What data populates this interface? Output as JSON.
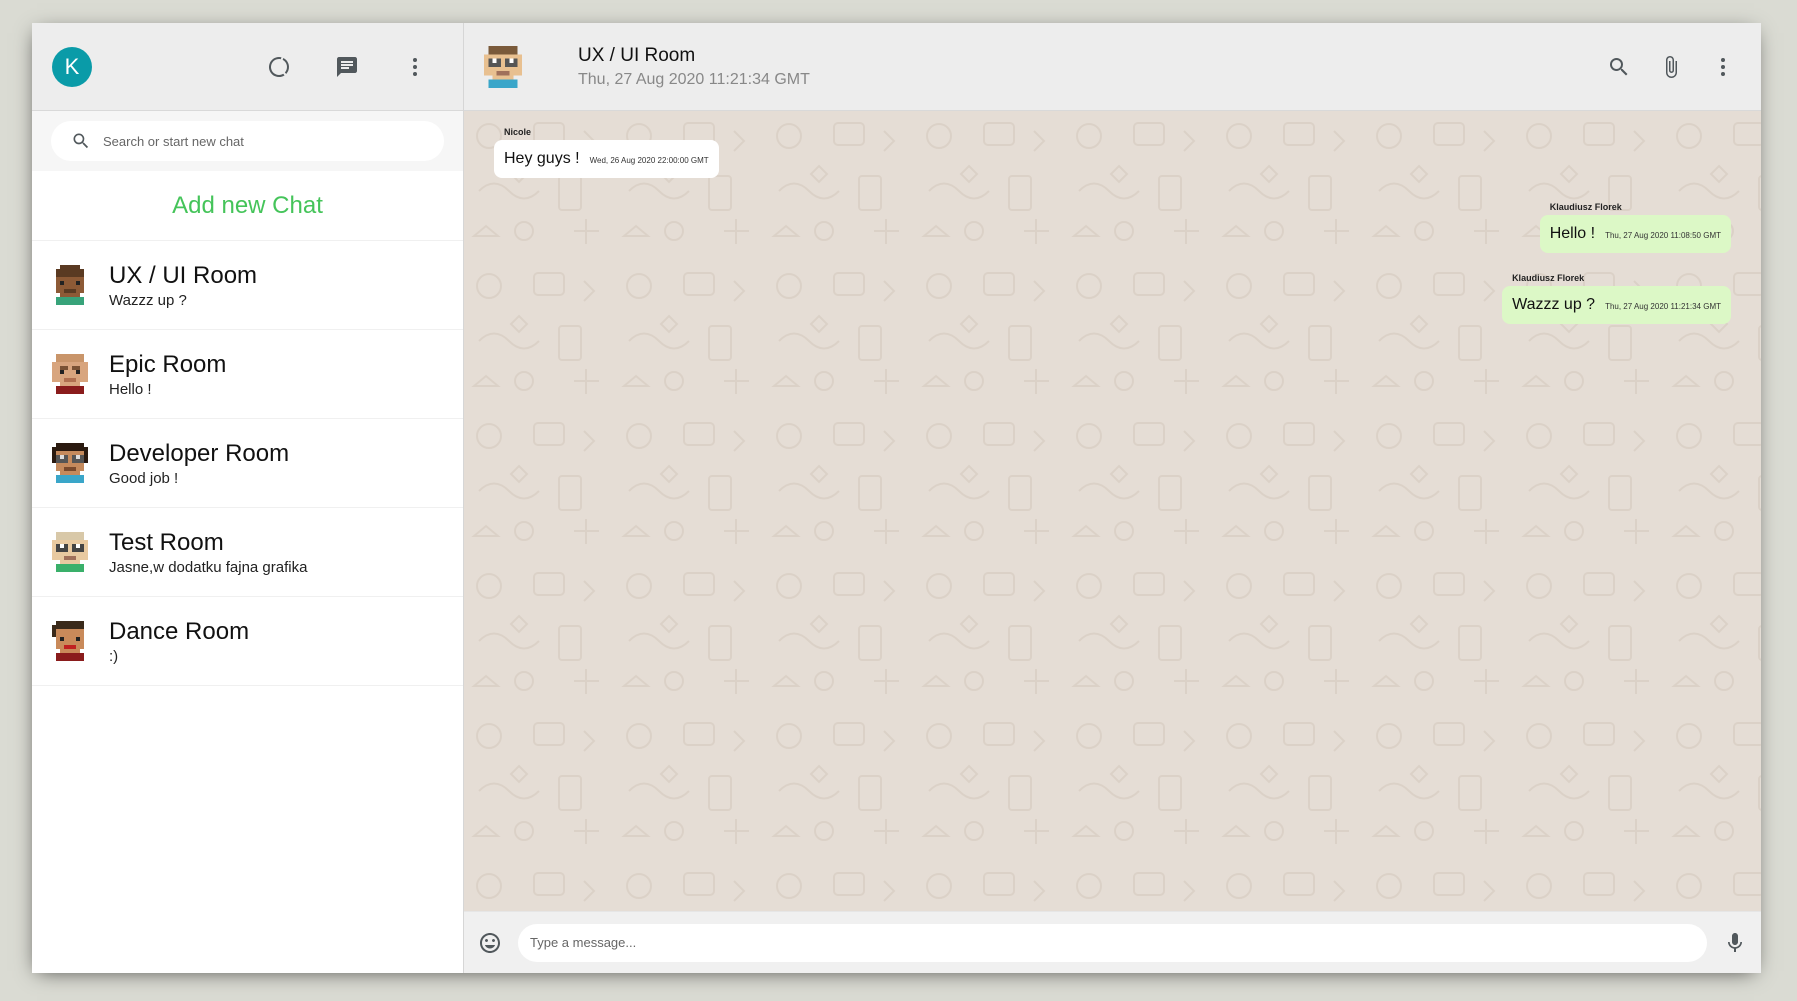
{
  "user": {
    "initial": "K"
  },
  "sidebar": {
    "search_placeholder": "Search or start new chat",
    "add_chat_label": "Add new Chat",
    "rooms": [
      {
        "name": "UX / UI Room",
        "last": "Wazzz up ?",
        "avatar": "pixel-avatar-brown"
      },
      {
        "name": "Epic Room",
        "last": "Hello !",
        "avatar": "pixel-avatar-tan"
      },
      {
        "name": "Developer Room",
        "last": "Good job !",
        "avatar": "pixel-avatar-glasses"
      },
      {
        "name": "Test Room",
        "last": "Jasne,w dodatku fajna grafika",
        "avatar": "pixel-avatar-green"
      },
      {
        "name": "Dance Room",
        "last": ":)",
        "avatar": "pixel-avatar-red"
      }
    ]
  },
  "chat": {
    "title": "UX / UI Room",
    "last_seen": "Thu, 27 Aug 2020 11:21:34 GMT",
    "messages": [
      {
        "name": "Nicole",
        "text": "Hey guys !",
        "time": "Wed, 26 Aug 2020 22:00:00 GMT",
        "mine": false
      },
      {
        "name": "Klaudiusz Florek",
        "text": "Hello !",
        "time": "Thu, 27 Aug 2020 11:08:50 GMT",
        "mine": true
      },
      {
        "name": "Klaudiusz Florek",
        "text": "Wazzz up ?",
        "time": "Thu, 27 Aug 2020 11:21:34 GMT",
        "mine": true
      }
    ],
    "input_placeholder": "Type a message..."
  },
  "colors": {
    "accent": "#45c45a",
    "avatar_bg": "#0a9ba8",
    "sent_bubble": "#dcf8c6",
    "chat_bg": "#e5ddd5"
  }
}
